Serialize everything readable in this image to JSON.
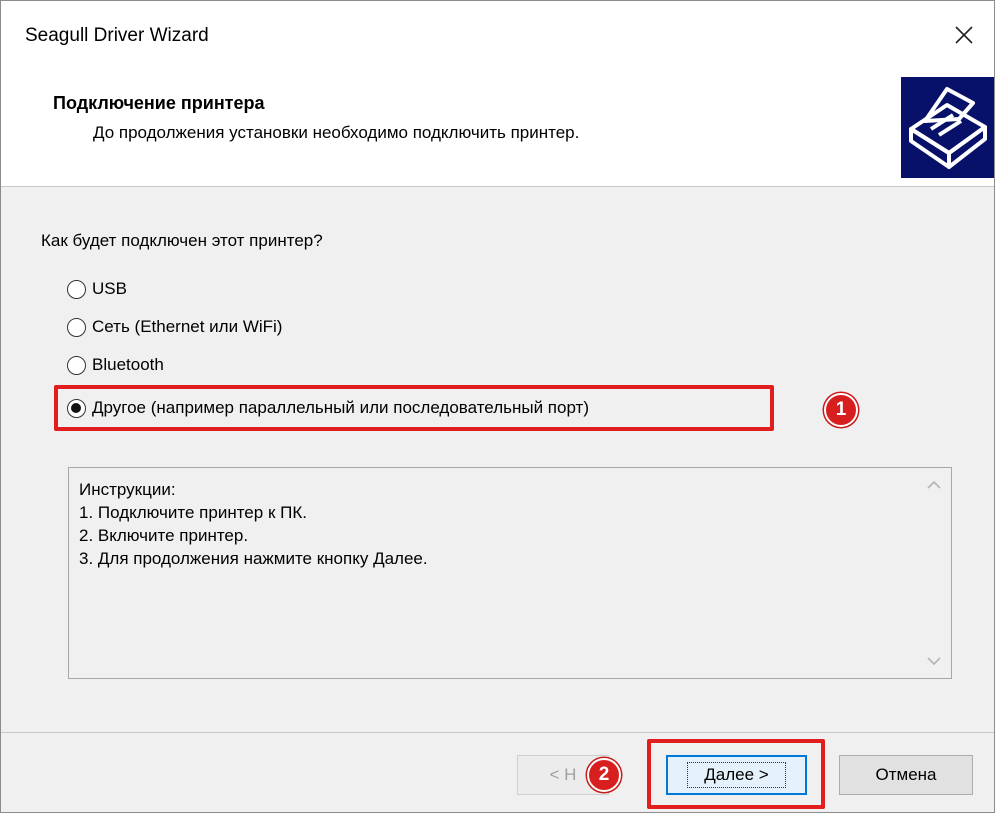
{
  "window": {
    "title": "Seagull Driver Wizard",
    "close_icon": "close-icon"
  },
  "header": {
    "title": "Подключение принтера",
    "subtitle": "До продолжения установки необходимо подключить принтер.",
    "logo_icon": "printer-icon"
  },
  "question": "Как будет подключен этот принтер?",
  "options": [
    {
      "label": "USB",
      "checked": false
    },
    {
      "label": "Сеть (Ethernet или WiFi)",
      "checked": false
    },
    {
      "label": "Bluetooth",
      "checked": false
    },
    {
      "label": "Другое (например параллельный или последовательный порт)",
      "checked": true
    }
  ],
  "instructions": {
    "lines": [
      "Инструкции:",
      "1. Подключите принтер к ПК.",
      "2. Включите принтер.",
      "3. Для продолжения нажмите кнопку Далее."
    ]
  },
  "buttons": {
    "back": "< Н",
    "next": "Далее >",
    "cancel": "Отмена"
  },
  "annotations": {
    "marker1": "1",
    "marker2": "2",
    "color": "#e21d1d"
  },
  "colors": {
    "logo_bg": "#07116a",
    "primary_border": "#0078d7"
  }
}
